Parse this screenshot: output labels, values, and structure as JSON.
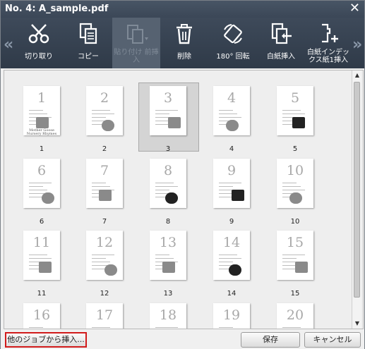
{
  "window": {
    "title": "No. 4: A_sample.pdf"
  },
  "toolbar": {
    "cut": "切り取り",
    "copy": "コピー",
    "paste_before": "貼り付け 前挿入",
    "delete": "削除",
    "rotate": "180° 回転",
    "insert_blank": "白紙挿入",
    "insert_tab": "白紙インデックス紙1挿入"
  },
  "pages": [
    {
      "label": "1",
      "num": "1"
    },
    {
      "label": "2",
      "num": "2"
    },
    {
      "label": "3",
      "num": "3"
    },
    {
      "label": "4",
      "num": "4"
    },
    {
      "label": "5",
      "num": "5"
    },
    {
      "label": "6",
      "num": "6"
    },
    {
      "label": "7",
      "num": "7"
    },
    {
      "label": "8",
      "num": "8"
    },
    {
      "label": "9",
      "num": "9"
    },
    {
      "label": "10",
      "num": "10"
    },
    {
      "label": "11",
      "num": "11"
    },
    {
      "label": "12",
      "num": "12"
    },
    {
      "label": "13",
      "num": "13"
    },
    {
      "label": "14",
      "num": "14"
    },
    {
      "label": "15",
      "num": "15"
    },
    {
      "num": "16"
    },
    {
      "num": "17"
    },
    {
      "num": "18"
    },
    {
      "num": "19"
    },
    {
      "num": "20"
    }
  ],
  "selected_page": "3",
  "cover": {
    "line1": "Mother Goose",
    "line2": "Nursery Rhymes"
  },
  "footer": {
    "insert_from_job": "他のジョブから挿入...",
    "save": "保存",
    "cancel": "キャンセル"
  },
  "colors": {
    "titlebar": "#3b4757",
    "highlight": "#d11b1b"
  }
}
